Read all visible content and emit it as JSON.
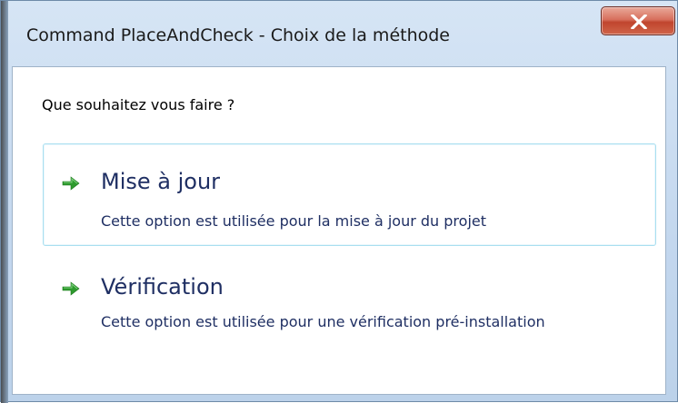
{
  "window": {
    "title": "Command PlaceAndCheck - Choix de la méthode"
  },
  "dialog": {
    "question": "Que souhaitez vous faire ?",
    "options": [
      {
        "title": "Mise à jour",
        "description": "Cette option est utilisée pour la mise à jour du projet",
        "icon": "green-arrow-icon"
      },
      {
        "title": "Vérification",
        "description": "Cette option est utilisée pour une vérification pré-installation",
        "icon": "green-arrow-icon"
      }
    ]
  },
  "colors": {
    "accent_arrow": "#2e9a2e",
    "option_text": "#1f2f63",
    "hover_border": "#a9dff0",
    "close_button": "#c0452e"
  }
}
